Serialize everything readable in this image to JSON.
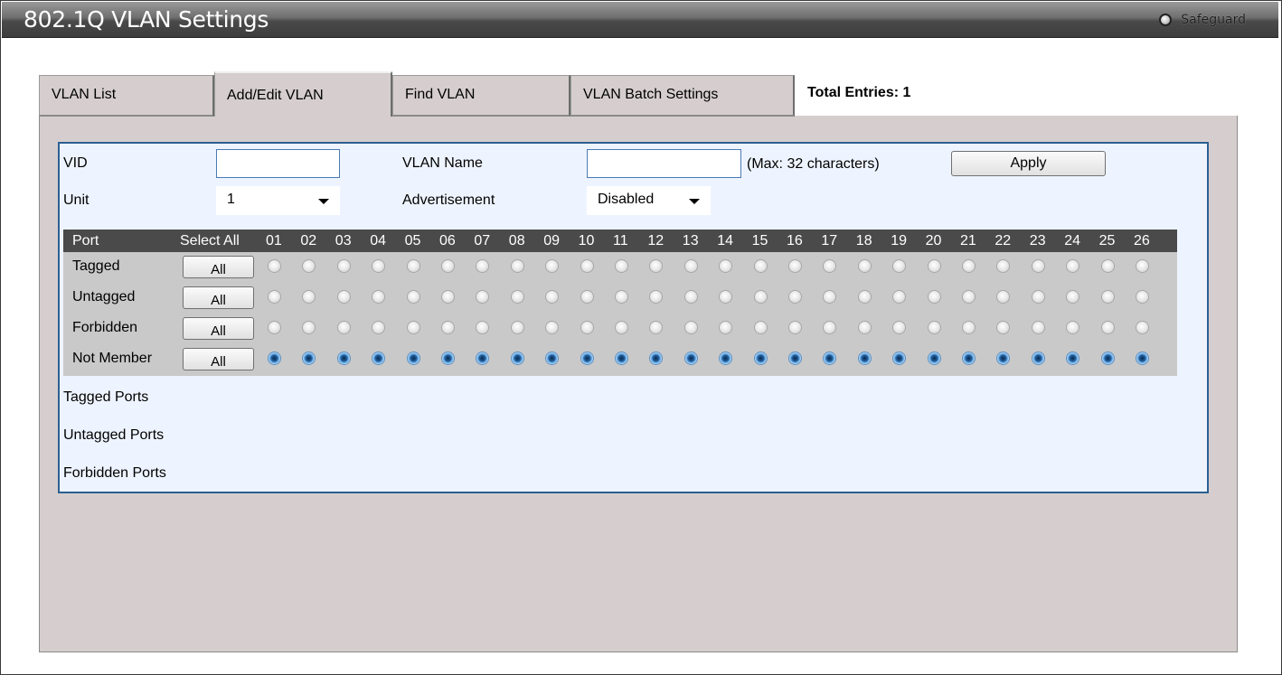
{
  "window": {
    "title": "802.1Q VLAN Settings",
    "safeguard_label": "Safeguard"
  },
  "tabs": [
    {
      "label": "VLAN List",
      "active": false
    },
    {
      "label": "Add/Edit VLAN",
      "active": true
    },
    {
      "label": "Find VLAN",
      "active": false
    },
    {
      "label": "VLAN Batch Settings",
      "active": false
    }
  ],
  "total_entries": "Total Entries: 1",
  "form": {
    "vid_label": "VID",
    "vid_value": "",
    "vlan_name_label": "VLAN Name",
    "vlan_name_value": "",
    "max_hint": "(Max: 32 characters)",
    "apply_label": "Apply",
    "unit_label": "Unit",
    "unit_value": "1",
    "advertisement_label": "Advertisement",
    "advertisement_value": "Disabled"
  },
  "ports": {
    "port_header": "Port",
    "select_all_header": "Select All",
    "numbers": [
      "01",
      "02",
      "03",
      "04",
      "05",
      "06",
      "07",
      "08",
      "09",
      "10",
      "11",
      "12",
      "13",
      "14",
      "15",
      "16",
      "17",
      "18",
      "19",
      "20",
      "21",
      "22",
      "23",
      "24",
      "25",
      "26"
    ],
    "rows": [
      {
        "label": "Tagged",
        "button": "All",
        "selected": false
      },
      {
        "label": "Untagged",
        "button": "All",
        "selected": false
      },
      {
        "label": "Forbidden",
        "button": "All",
        "selected": false
      },
      {
        "label": "Not Member",
        "button": "All",
        "selected": true
      }
    ]
  },
  "summary": {
    "tagged_ports": "Tagged Ports",
    "untagged_ports": "Untagged Ports",
    "forbidden_ports": "Forbidden Ports"
  }
}
